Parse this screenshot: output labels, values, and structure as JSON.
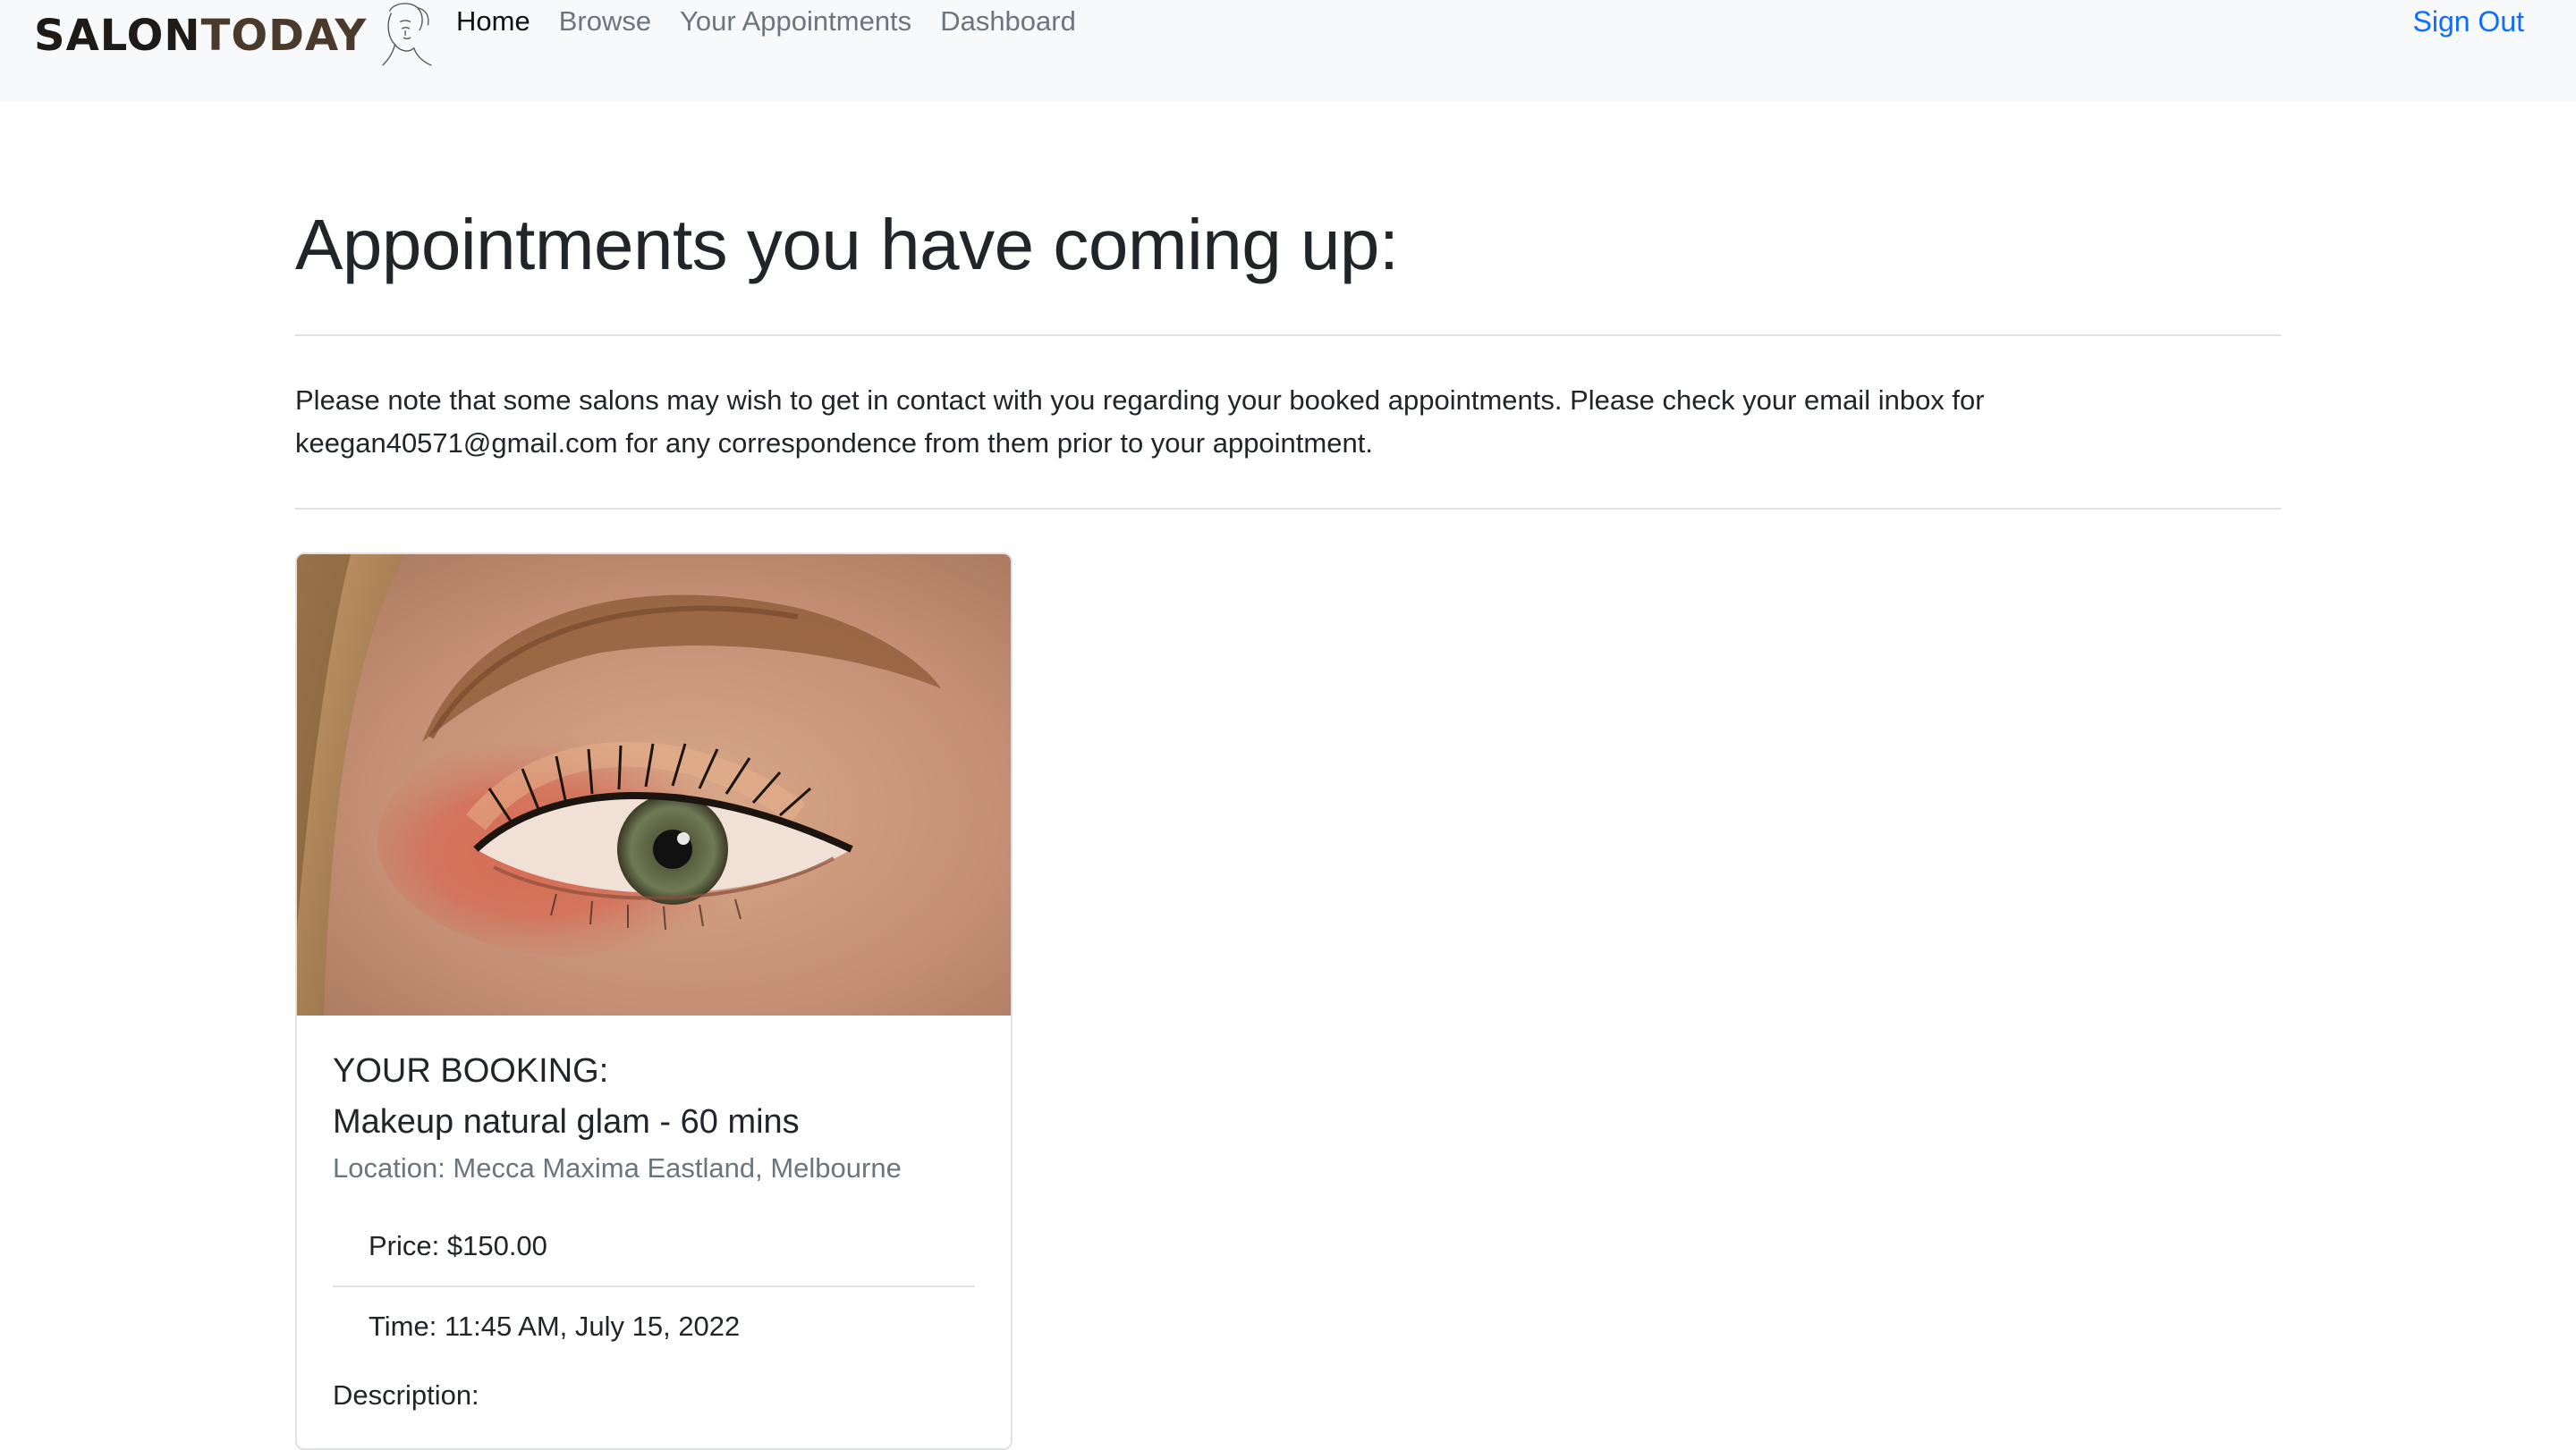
{
  "navbar": {
    "brand": {
      "part1": "SALON",
      "part2": "TODAY"
    },
    "links": [
      "Home",
      "Browse",
      "Your Appointments",
      "Dashboard"
    ],
    "sign_out": "Sign Out"
  },
  "page": {
    "title": "Appointments you have coming up:",
    "note": "Please note that some salons may wish to get in contact with you regarding your booked appointments. Please check your email inbox for keegan40571@gmail.com for any correspondence from them prior to your appointment."
  },
  "booking": {
    "label": "YOUR BOOKING:",
    "service": "Makeup natural glam - 60 mins",
    "location": "Location: Mecca Maxima Eastland, Melbourne",
    "price": "Price: $150.00",
    "time": "Time: 11:45 AM, July 15, 2022",
    "description_label": "Description:"
  },
  "colors": {
    "navbar_bg": "#f8f9fa",
    "link_active": "#111111",
    "link_muted": "#6c757d",
    "sign_out": "#0d6efd"
  }
}
